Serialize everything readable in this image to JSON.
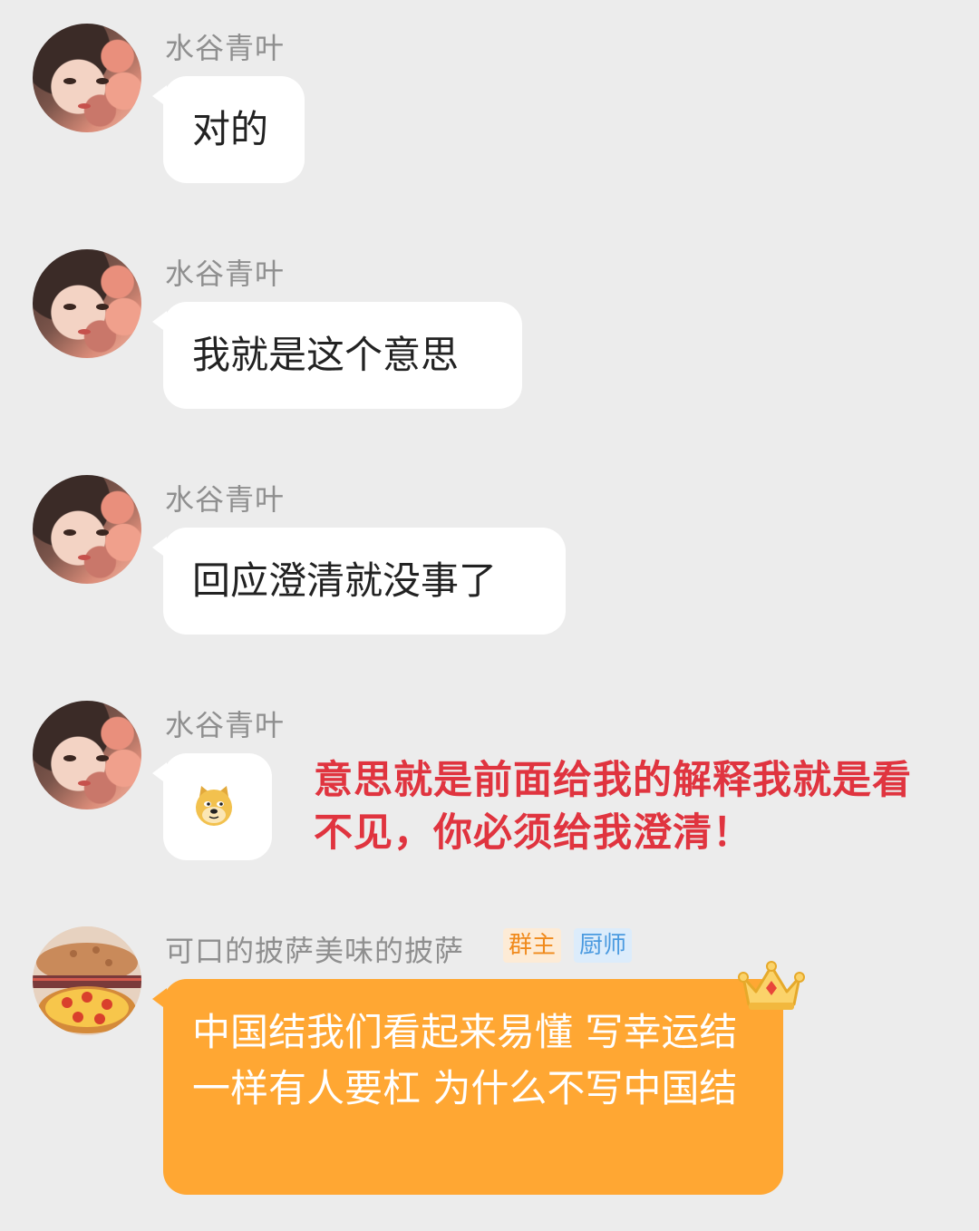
{
  "messages": [
    {
      "sender": "水谷青叶",
      "text": "对的"
    },
    {
      "sender": "水谷青叶",
      "text": "我就是这个意思"
    },
    {
      "sender": "水谷青叶",
      "text": "回应澄清就没事了"
    },
    {
      "sender": "水谷青叶",
      "emoji": "doge-emoji"
    },
    {
      "sender": "可口的披萨美味的披萨",
      "badges": [
        "群主",
        "厨师"
      ],
      "text": "中国结我们看起来易懂 写幸运结一样有人要杠 为什么不写中国结",
      "decoration": "crown-icon"
    }
  ],
  "overlay_caption": "意思就是前面给我的解释我就是看不见，你必须给我澄清！",
  "colors": {
    "background": "#ececec",
    "bubble": "#ffffff",
    "owner_bubble": "#ffa733",
    "caption": "#e0343f",
    "badge_owner_bg": "#fdebd6",
    "badge_owner_text": "#f08a1c",
    "badge_chef_bg": "#dcecfb",
    "badge_chef_text": "#4a9ae0"
  }
}
